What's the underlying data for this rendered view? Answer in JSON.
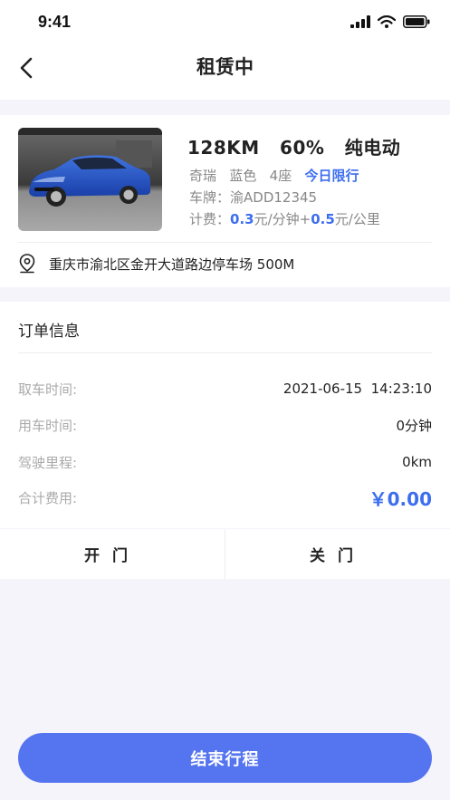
{
  "status_bar": {
    "time": "9:41"
  },
  "nav": {
    "title": "租赁中"
  },
  "car": {
    "specs": "128KM   60%   纯电动",
    "brand": "奇瑞",
    "color": "蓝色",
    "seats": "4座",
    "limit": "今日限行",
    "plate_label": "车牌：",
    "plate": "渝ADD12345",
    "fee_label": "计费：",
    "fee_minute_value": "0.3",
    "fee_minute_unit": "元/分钟+",
    "fee_km_value": "0.5",
    "fee_km_unit": "元/公里"
  },
  "location": {
    "address": "重庆市渝北区金开大道路边停车场 500M"
  },
  "order": {
    "title": "订单信息",
    "rows": [
      {
        "label": "取车时间:",
        "value": "2021-06-15  14:23:10"
      },
      {
        "label": "用车时间:",
        "value": "0分钟"
      },
      {
        "label": "驾驶里程:",
        "value": "0km"
      },
      {
        "label": "合计费用:",
        "value": "￥0.00"
      }
    ]
  },
  "doors": {
    "open": "开门",
    "close": "关门"
  },
  "end_button": "结束行程",
  "colors": {
    "accent": "#3d6ef0",
    "button": "#5574f0",
    "background": "#f5f4fb"
  }
}
